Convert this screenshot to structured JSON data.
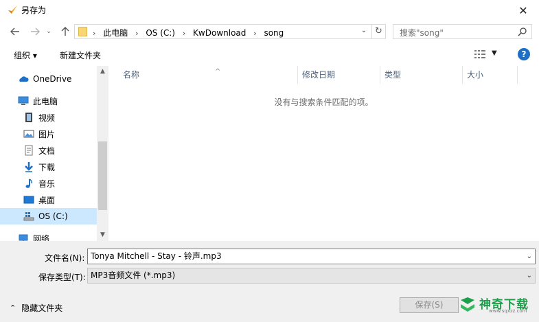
{
  "window": {
    "title": "另存为"
  },
  "address": {
    "crumbs": [
      "此电脑",
      "OS (C:)",
      "KwDownload",
      "song"
    ]
  },
  "search": {
    "placeholder": "搜索\"song\""
  },
  "toolbar": {
    "organize": "组织 ▾",
    "new_folder": "新建文件夹"
  },
  "nav": {
    "items": [
      {
        "label": "OneDrive",
        "icon": "cloud-icon"
      },
      {
        "label": "此电脑",
        "icon": "computer-icon"
      },
      {
        "label": "视频",
        "icon": "video-icon"
      },
      {
        "label": "图片",
        "icon": "picture-icon"
      },
      {
        "label": "文档",
        "icon": "document-icon"
      },
      {
        "label": "下载",
        "icon": "download-icon"
      },
      {
        "label": "音乐",
        "icon": "music-icon"
      },
      {
        "label": "桌面",
        "icon": "desktop-icon"
      },
      {
        "label": "OS (C:)",
        "icon": "drive-icon"
      },
      {
        "label": "网络",
        "icon": "network-icon"
      }
    ]
  },
  "columns": [
    "名称",
    "修改日期",
    "类型",
    "大小"
  ],
  "empty_message": "没有与搜索条件匹配的项。",
  "form": {
    "filename_label": "文件名(N):",
    "filename_value": "Tonya Mitchell - Stay - 铃声.mp3",
    "filetype_label": "保存类型(T):",
    "filetype_value": "MP3音频文件 (*.mp3)"
  },
  "footer": {
    "hide_folders": "隐藏文件夹",
    "save": "保存(S)",
    "watermark": "神奇下载",
    "watermark_url": "www.sqxzz.com"
  },
  "colors": {
    "accent": "#1f6fc5",
    "selected": "#cce8ff",
    "watermark": "#1d9e4a"
  }
}
